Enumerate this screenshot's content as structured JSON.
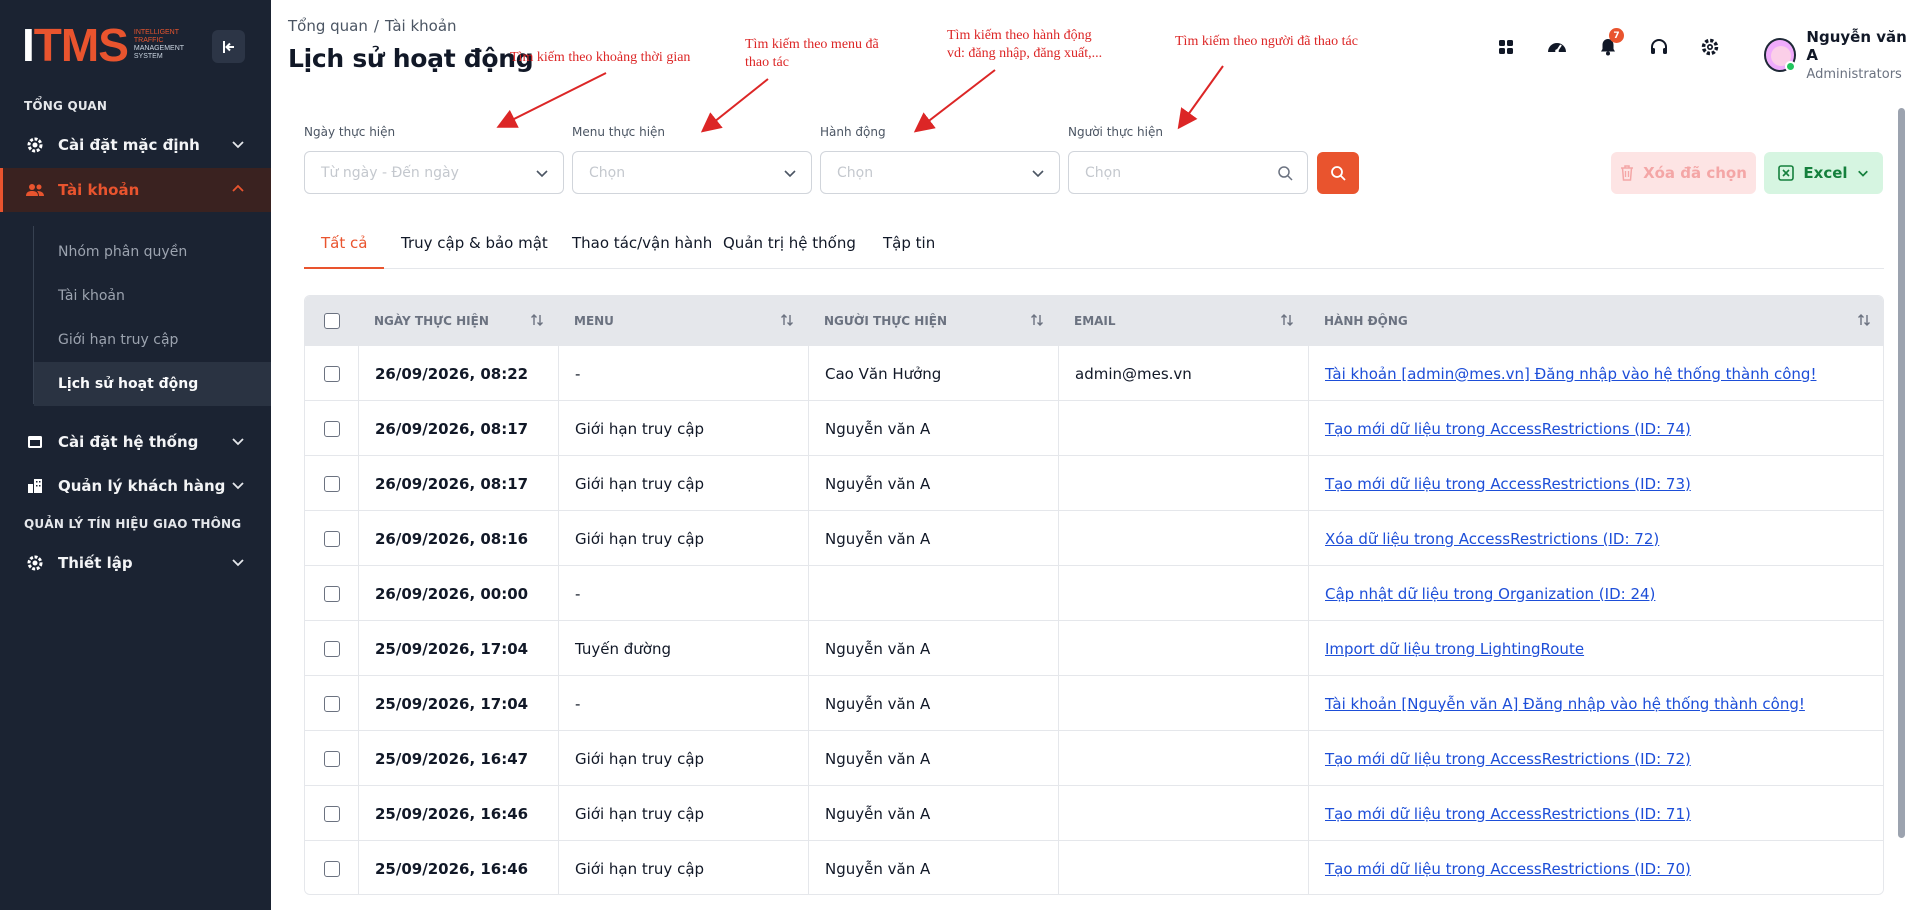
{
  "sidebar": {
    "brand_main_a": "I",
    "brand_main_b": "TMS",
    "brand_sub_1": "Intelligent",
    "brand_sub_2": "Traffic",
    "brand_sub_3": "Management",
    "brand_sub_4": "System",
    "sections": [
      "TỔNG QUAN",
      "QUẢN LÝ TÍN HIỆU GIAO THÔNG"
    ],
    "items": [
      {
        "label": "Cài đặt mặc định",
        "icon": "gear-icon"
      },
      {
        "label": "Tài khoản",
        "icon": "users-icon"
      },
      {
        "label": "Cài đặt hệ thống",
        "icon": "window-icon"
      },
      {
        "label": "Quản lý khách hàng",
        "icon": "building-icon"
      },
      {
        "label": "Thiết lập",
        "icon": "gear-icon"
      }
    ],
    "sub_items": [
      "Nhóm phân quyền",
      "Tài khoản",
      "Giới hạn truy cập",
      "Lịch sử hoạt động"
    ]
  },
  "header": {
    "breadcrumb": [
      "Tổng quan",
      "Tài khoản"
    ],
    "breadcrumb_sep": "/",
    "title": "Lịch sử hoạt động",
    "notification_count": "7",
    "user_name": "Nguyễn văn A",
    "user_role": "Administrators"
  },
  "annotations": {
    "date": "Tìm kiếm theo khoảng thời gian",
    "menu_1": "Tìm kiếm theo menu đã",
    "menu_2": "thao tác",
    "action_1": "Tìm kiếm theo hành động",
    "action_2": "vd: đăng nhập, đăng xuất,...",
    "user": "Tìm kiếm theo người đã thao tác"
  },
  "filters": {
    "date_label": "Ngày thực hiện",
    "date_placeholder": "Từ ngày - Đến ngày",
    "menu_label": "Menu thực hiện",
    "menu_placeholder": "Chọn",
    "action_label": "Hành động",
    "action_placeholder": "Chọn",
    "user_label": "Người thực hiện",
    "user_placeholder": "Chọn",
    "delete_label": "Xóa đã chọn",
    "excel_label": "Excel"
  },
  "tabs": [
    "Tất cả",
    "Truy cập & bảo mật",
    "Thao tác/vận hành",
    "Quản trị hệ thống",
    "Tập tin"
  ],
  "table": {
    "columns": [
      "NGÀY THỰC HIỆN",
      "MENU",
      "NGƯỜI THỰC HIỆN",
      "EMAIL",
      "HÀNH ĐỘNG"
    ],
    "rows": [
      {
        "date": "26/09/2026, 08:22",
        "menu": "-",
        "user": "Cao Văn Hưởng",
        "email": "admin@mes.vn",
        "action": "Tài khoản [admin@mes.vn] Đăng nhập vào hệ thống thành công!"
      },
      {
        "date": "26/09/2026, 08:17",
        "menu": "Giới hạn truy cập",
        "user": "Nguyễn văn A",
        "email": "",
        "action": "Tạo mới dữ liệu trong AccessRestrictions (ID: 74)"
      },
      {
        "date": "26/09/2026, 08:17",
        "menu": "Giới hạn truy cập",
        "user": "Nguyễn văn A",
        "email": "",
        "action": "Tạo mới dữ liệu trong AccessRestrictions (ID: 73)"
      },
      {
        "date": "26/09/2026, 08:16",
        "menu": "Giới hạn truy cập",
        "user": "Nguyễn văn A",
        "email": "",
        "action": "Xóa dữ liệu trong AccessRestrictions (ID: 72)"
      },
      {
        "date": "26/09/2026, 00:00",
        "menu": "-",
        "user": "",
        "email": "",
        "action": "Cập nhật dữ liệu trong Organization (ID: 24)"
      },
      {
        "date": "25/09/2026, 17:04",
        "menu": "Tuyến đường",
        "user": "Nguyễn văn A",
        "email": "",
        "action": "Import dữ liệu trong LightingRoute"
      },
      {
        "date": "25/09/2026, 17:04",
        "menu": "-",
        "user": "Nguyễn văn A",
        "email": "",
        "action": "Tài khoản [Nguyễn văn A] Đăng nhập vào hệ thống thành công!"
      },
      {
        "date": "25/09/2026, 16:47",
        "menu": "Giới hạn truy cập",
        "user": "Nguyễn văn A",
        "email": "",
        "action": "Tạo mới dữ liệu trong AccessRestrictions (ID: 72)"
      },
      {
        "date": "25/09/2026, 16:46",
        "menu": "Giới hạn truy cập",
        "user": "Nguyễn văn A",
        "email": "",
        "action": "Tạo mới dữ liệu trong AccessRestrictions (ID: 71)"
      },
      {
        "date": "25/09/2026, 16:46",
        "menu": "Giới hạn truy cập",
        "user": "Nguyễn văn A",
        "email": "",
        "action": "Tạo mới dữ liệu trong AccessRestrictions (ID: 70)"
      }
    ]
  },
  "colors": {
    "accent": "#e9542e",
    "sidebar_bg": "#1b2332",
    "link": "#1d4ed8",
    "annotation": "#dc2626"
  }
}
